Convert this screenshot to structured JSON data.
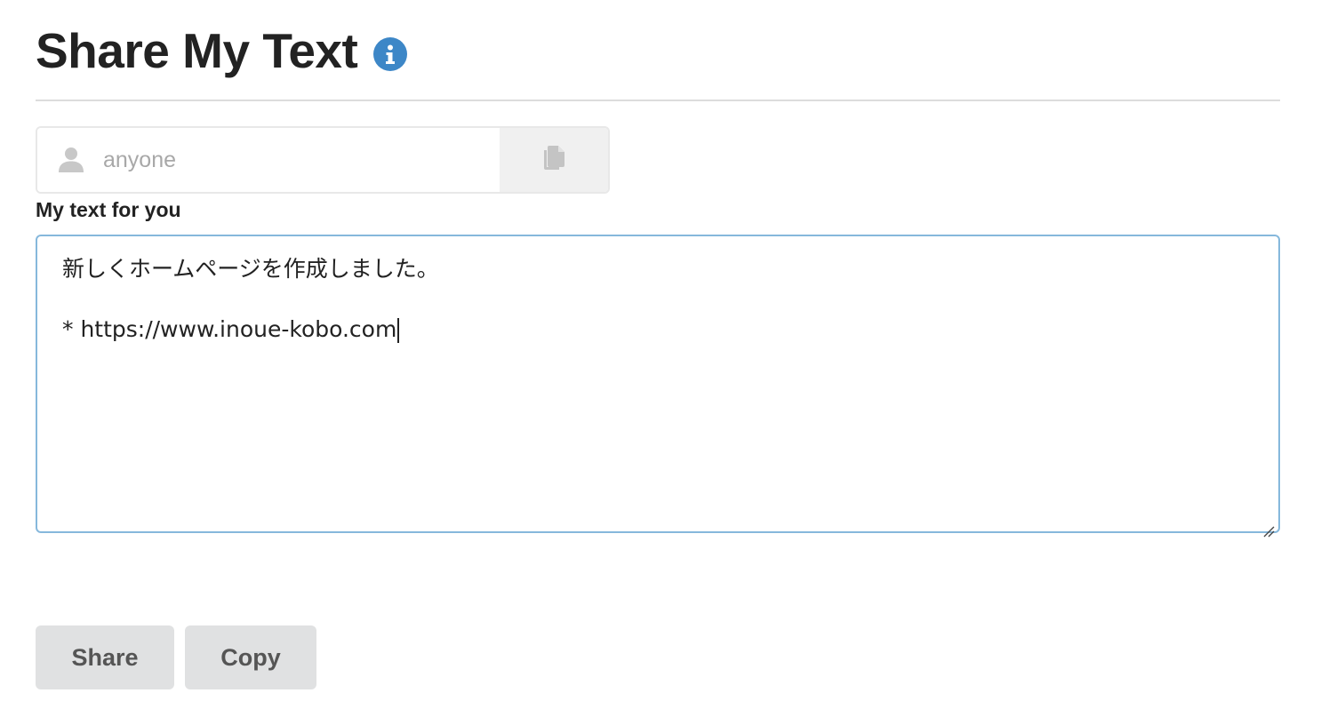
{
  "header": {
    "title": "Share My Text",
    "info_icon": "info-icon",
    "accent_color": "#3d87c7"
  },
  "recipient": {
    "placeholder": "anyone",
    "value": "",
    "user_icon": "user-icon",
    "copy_icon": "copy-icon"
  },
  "message": {
    "label": "My text for you",
    "lines": [
      "新しくホームページを作成しました。",
      "",
      "* https://www.inoue-kobo.com"
    ],
    "focus_color": "#86b8dc"
  },
  "actions": {
    "share_label": "Share",
    "copy_label": "Copy"
  }
}
